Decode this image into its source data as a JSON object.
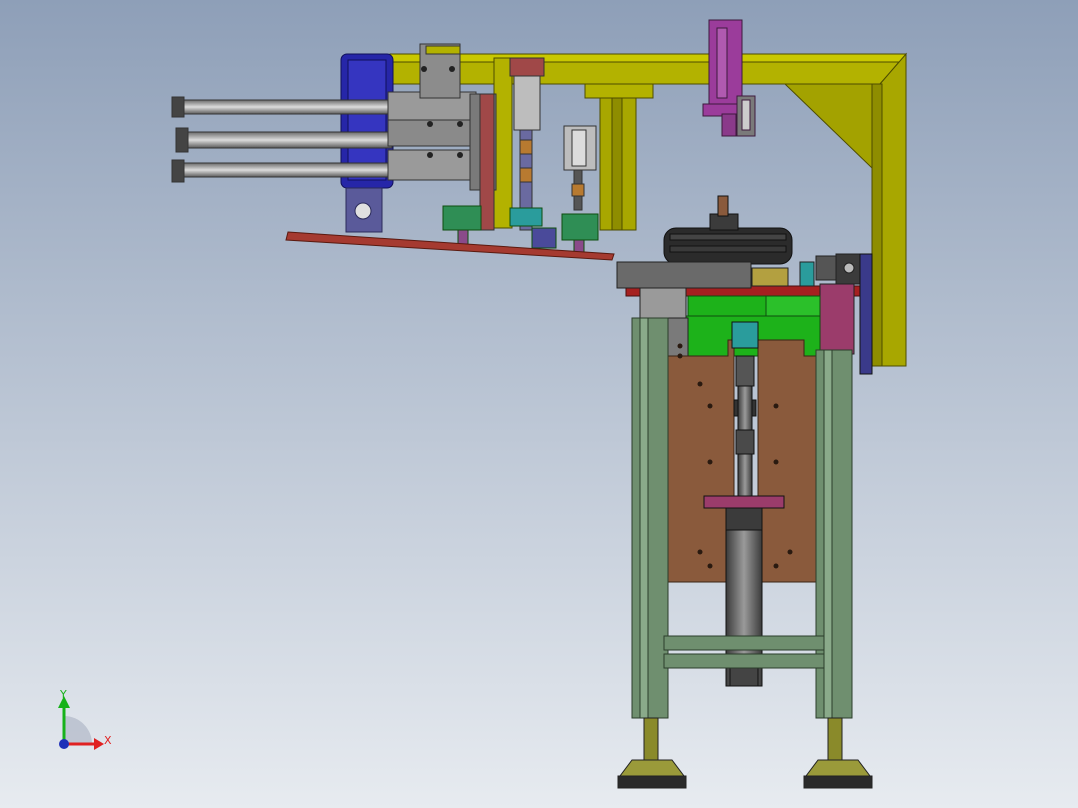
{
  "view": {
    "background_top": "#8e9fb8",
    "background_bottom": "#e7ebf0"
  },
  "triad": {
    "y_label": "Y",
    "x_label": "X",
    "y_color": "#17b21a",
    "x_color": "#e02121",
    "z_color": "#1d2fb8"
  },
  "colors": {
    "frame_yellow": "#b3b200",
    "frame_yellow_dark": "#7d7c00",
    "plate_brown": "#8a5a3c",
    "leg_green": "#6f8f6f",
    "green_block": "#1db21a",
    "gantry_blue": "#2626a8",
    "magenta": "#9b3c9b",
    "rail_red": "#a53a30",
    "steel_gray": "#8c8c8c",
    "dark": "#2a2a2a",
    "teal": "#2a9c9c"
  }
}
